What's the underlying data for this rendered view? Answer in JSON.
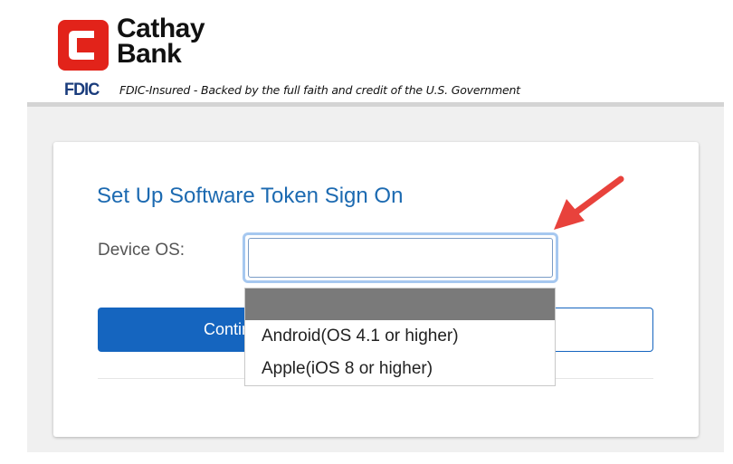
{
  "brand": {
    "name_line1": "Cathay",
    "name_line2": "Bank",
    "accent_color": "#e2231a",
    "logo_icon": "cathay-bank-logo-icon"
  },
  "fdic": {
    "logo": "FDIC",
    "text": "FDIC-Insured - Backed by the full faith and credit of the U.S. Government"
  },
  "form": {
    "title": "Set Up Software Token Sign On",
    "device_os_label": "Device OS:",
    "device_os_value": "",
    "continue_label": "Continue",
    "cancel_label": ""
  },
  "dropdown": {
    "options": [
      "",
      "Android(OS 4.1 or higher)",
      "Apple(iOS 8 or higher)"
    ],
    "highlighted_index": 0
  },
  "annotation": {
    "arrow_icon": "red-arrow-icon",
    "color": "#e8423c"
  }
}
